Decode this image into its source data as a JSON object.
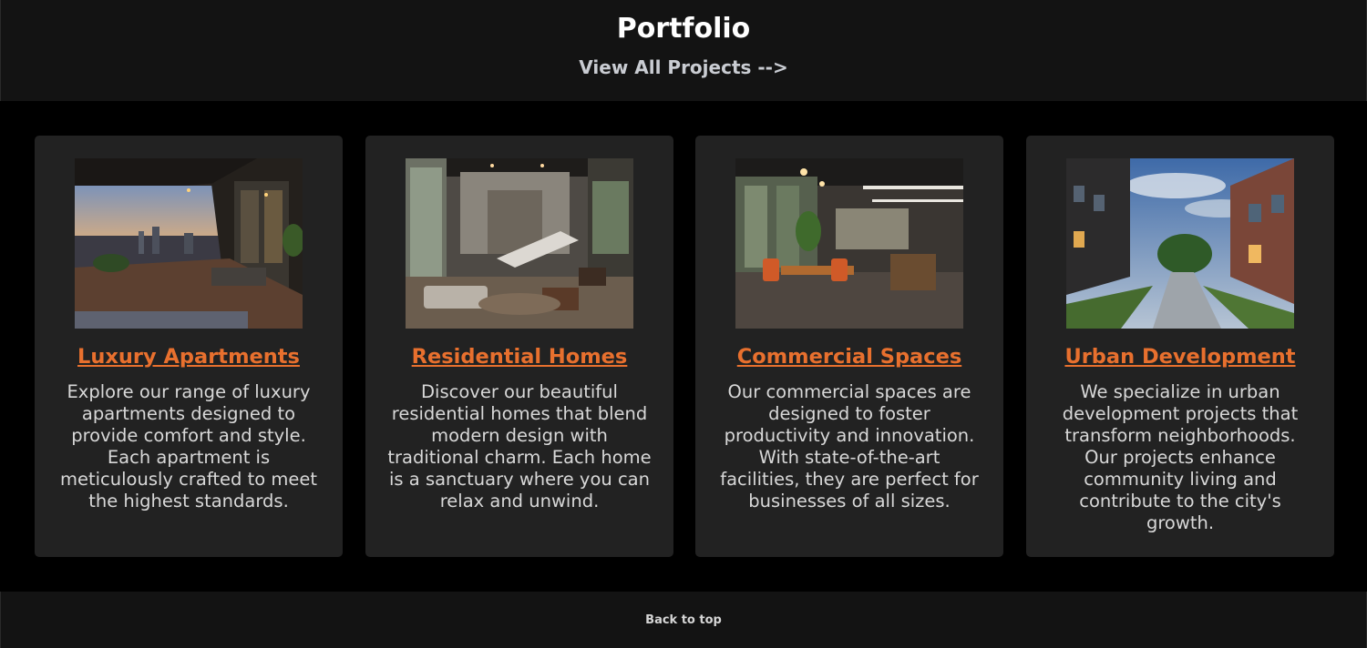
{
  "header": {
    "title": "Portfolio",
    "view_all": "View All Projects -->"
  },
  "cards": [
    {
      "title": "Luxury Apartments",
      "description": "Explore our range of luxury apartments designed to provide comfort and style. Each apartment is meticulously crafted to meet the highest standards."
    },
    {
      "title": "Residential Homes",
      "description": "Discover our beautiful residential homes that blend modern design with traditional charm. Each home is a sanctuary where you can relax and unwind."
    },
    {
      "title": "Commercial Spaces",
      "description": "Our commercial spaces are designed to foster productivity and innovation. With state-of-the-art facilities, they are perfect for businesses of all sizes."
    },
    {
      "title": "Urban Development",
      "description": "We specialize in urban development projects that transform neighborhoods. Our projects enhance community living and contribute to the city's growth."
    }
  ],
  "footer": {
    "back_to_top": "Back to top"
  },
  "colors": {
    "accent": "#e8702e",
    "card_bg": "#222222",
    "header_bg": "#131313",
    "page_bg": "#000000"
  }
}
